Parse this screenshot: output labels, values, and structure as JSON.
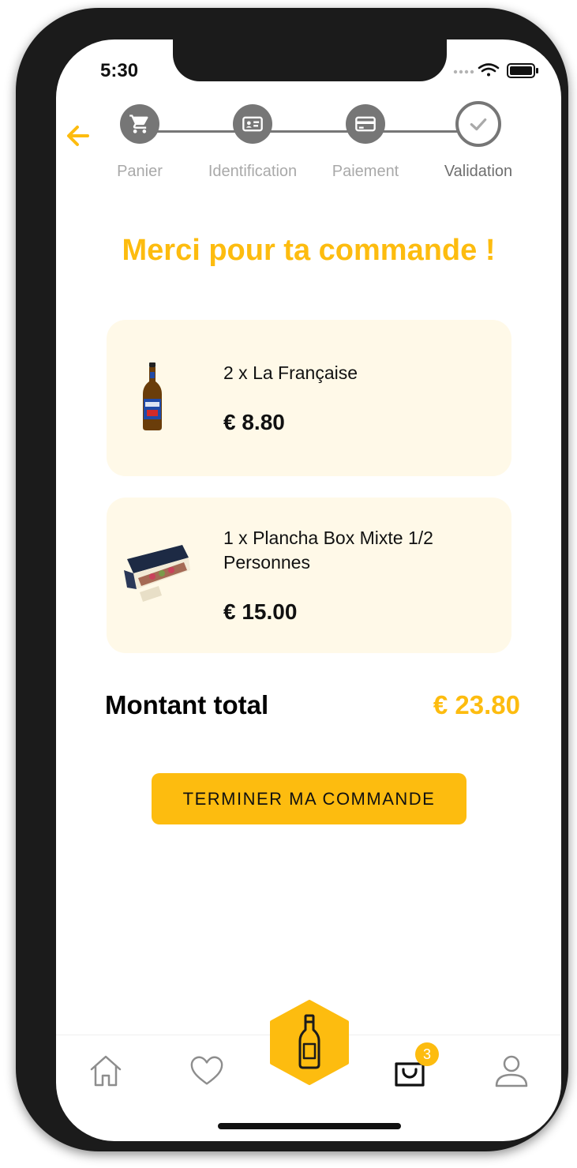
{
  "status_bar": {
    "time": "5:30"
  },
  "stepper": {
    "steps": [
      {
        "label": "Panier",
        "icon": "cart-icon"
      },
      {
        "label": "Identification",
        "icon": "id-card-icon"
      },
      {
        "label": "Paiement",
        "icon": "credit-card-icon"
      },
      {
        "label": "Validation",
        "icon": "check-icon"
      }
    ],
    "current_index": 3
  },
  "title": "Merci pour ta commande !",
  "order_items": [
    {
      "name": "2 x La Française",
      "price": "€ 8.80",
      "image": "beer-bottle-image"
    },
    {
      "name": "1 x Plancha Box Mixte 1/2 Personnes",
      "price": "€ 15.00",
      "image": "plancha-box-image"
    }
  ],
  "total": {
    "label": "Montant total",
    "value": "€ 23.80"
  },
  "cta_label": "TERMINER MA COMMANDE",
  "tab_bar": {
    "items": [
      "home-icon",
      "heart-icon",
      "bottle-icon",
      "bag-icon",
      "user-icon"
    ],
    "cart_badge": "3"
  },
  "colors": {
    "accent": "#fdbc0f",
    "card_background": "#fff9e8",
    "stepper_gray": "#767676",
    "step_label_gray": "#a9a9a9"
  }
}
